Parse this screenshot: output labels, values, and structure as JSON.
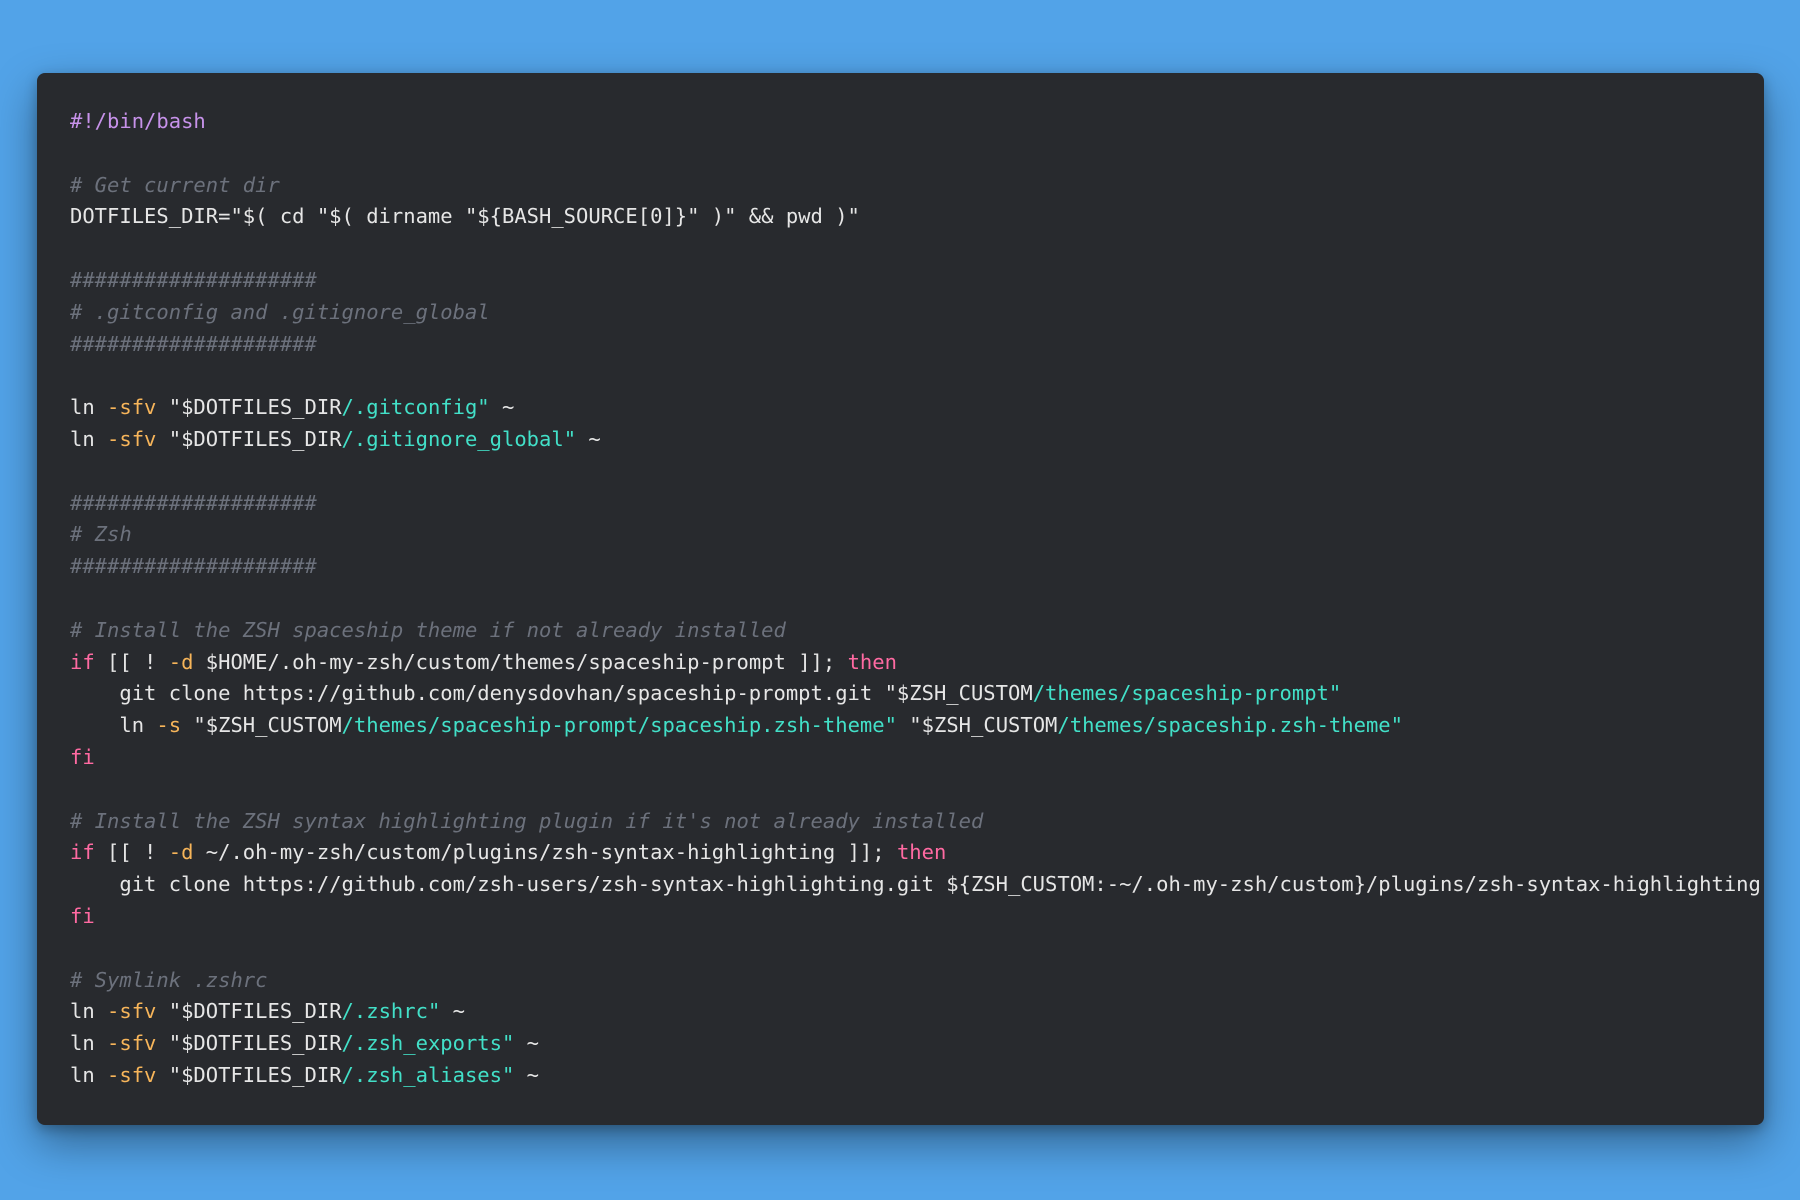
{
  "colors": {
    "background": "#52a3e8",
    "window": "#282a2e",
    "text": "#e6e6e6",
    "comment": "#6c717c",
    "keyword": "#ff6aa2",
    "flag": "#f7b55a",
    "path": "#42e0c8",
    "shebang": "#c792ea"
  },
  "code": {
    "lines": [
      [
        {
          "t": "shebang",
          "v": "#!/bin/bash"
        }
      ],
      [],
      [
        {
          "t": "comment",
          "v": "# Get current dir"
        }
      ],
      [
        {
          "t": "text",
          "v": "DOTFILES_DIR=\"$( cd \"$( dirname \"${BASH_SOURCE[0]}\" )\" && pwd )\""
        }
      ],
      [],
      [
        {
          "t": "comment",
          "v": "####################"
        }
      ],
      [
        {
          "t": "comment",
          "v": "# .gitconfig and .gitignore_global"
        }
      ],
      [
        {
          "t": "comment",
          "v": "####################"
        }
      ],
      [],
      [
        {
          "t": "text",
          "v": "ln "
        },
        {
          "t": "flag",
          "v": "-sfv"
        },
        {
          "t": "text",
          "v": " \"$DOTFILES_DIR"
        },
        {
          "t": "path",
          "v": "/.gitconfig\""
        },
        {
          "t": "text",
          "v": " ~"
        }
      ],
      [
        {
          "t": "text",
          "v": "ln "
        },
        {
          "t": "flag",
          "v": "-sfv"
        },
        {
          "t": "text",
          "v": " \"$DOTFILES_DIR"
        },
        {
          "t": "path",
          "v": "/.gitignore_global\""
        },
        {
          "t": "text",
          "v": " ~"
        }
      ],
      [],
      [
        {
          "t": "comment",
          "v": "####################"
        }
      ],
      [
        {
          "t": "comment",
          "v": "# Zsh"
        }
      ],
      [
        {
          "t": "comment",
          "v": "####################"
        }
      ],
      [],
      [
        {
          "t": "comment",
          "v": "# Install the ZSH spaceship theme if not already installed"
        }
      ],
      [
        {
          "t": "keyword",
          "v": "if"
        },
        {
          "t": "text",
          "v": " [[ ! "
        },
        {
          "t": "flag",
          "v": "-d"
        },
        {
          "t": "text",
          "v": " $HOME/.oh-my-zsh/custom/themes/spaceship-prompt ]]; "
        },
        {
          "t": "keyword",
          "v": "then"
        }
      ],
      [
        {
          "t": "text",
          "v": "    git clone https://github.com/denysdovhan/spaceship-prompt.git \"$ZSH_CUSTOM"
        },
        {
          "t": "path",
          "v": "/themes/spaceship-prompt\""
        }
      ],
      [
        {
          "t": "text",
          "v": "    ln "
        },
        {
          "t": "flag",
          "v": "-s"
        },
        {
          "t": "text",
          "v": " \"$ZSH_CUSTOM"
        },
        {
          "t": "path",
          "v": "/themes/spaceship-prompt/spaceship.zsh-theme\""
        },
        {
          "t": "text",
          "v": " \"$ZSH_CUSTOM"
        },
        {
          "t": "path",
          "v": "/themes/spaceship.zsh-theme\""
        }
      ],
      [
        {
          "t": "keyword",
          "v": "fi"
        }
      ],
      [],
      [
        {
          "t": "comment",
          "v": "# Install the ZSH syntax highlighting plugin if it's not already installed"
        }
      ],
      [
        {
          "t": "keyword",
          "v": "if"
        },
        {
          "t": "text",
          "v": " [[ ! "
        },
        {
          "t": "flag",
          "v": "-d"
        },
        {
          "t": "text",
          "v": " ~/.oh-my-zsh/custom/plugins/zsh-syntax-highlighting ]]; "
        },
        {
          "t": "keyword",
          "v": "then"
        }
      ],
      [
        {
          "t": "text",
          "v": "    git clone https://github.com/zsh-users/zsh-syntax-highlighting.git ${ZSH_CUSTOM:-~/.oh-my-zsh/custom}/plugins/zsh-syntax-highlighting"
        }
      ],
      [
        {
          "t": "keyword",
          "v": "fi"
        }
      ],
      [],
      [
        {
          "t": "comment",
          "v": "# Symlink .zshrc"
        }
      ],
      [
        {
          "t": "text",
          "v": "ln "
        },
        {
          "t": "flag",
          "v": "-sfv"
        },
        {
          "t": "text",
          "v": " \"$DOTFILES_DIR"
        },
        {
          "t": "path",
          "v": "/.zshrc\""
        },
        {
          "t": "text",
          "v": " ~"
        }
      ],
      [
        {
          "t": "text",
          "v": "ln "
        },
        {
          "t": "flag",
          "v": "-sfv"
        },
        {
          "t": "text",
          "v": " \"$DOTFILES_DIR"
        },
        {
          "t": "path",
          "v": "/.zsh_exports\""
        },
        {
          "t": "text",
          "v": " ~"
        }
      ],
      [
        {
          "t": "text",
          "v": "ln "
        },
        {
          "t": "flag",
          "v": "-sfv"
        },
        {
          "t": "text",
          "v": " \"$DOTFILES_DIR"
        },
        {
          "t": "path",
          "v": "/.zsh_aliases\""
        },
        {
          "t": "text",
          "v": " ~"
        }
      ]
    ]
  }
}
